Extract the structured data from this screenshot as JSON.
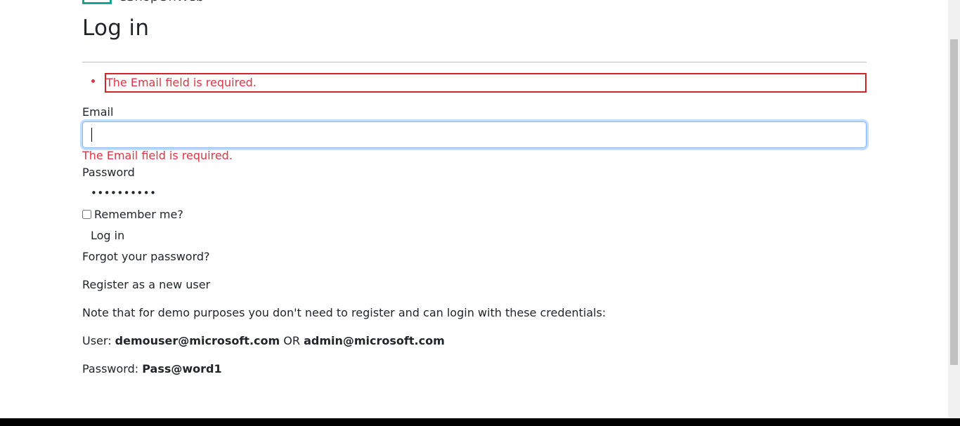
{
  "header": {
    "brand_text": "eShopOnWeb",
    "cart_icon": "cart-icon"
  },
  "page": {
    "title": "Log in"
  },
  "validation_summary": {
    "items": [
      "The Email field is required."
    ],
    "color": "#dc3545"
  },
  "form": {
    "email_label": "Email",
    "email_value": "",
    "email_error": "The Email field is required.",
    "password_label": "Password",
    "password_value": "••••••••••",
    "remember_label": "Remember me?",
    "remember_checked": false,
    "login_button": "Log in"
  },
  "links": {
    "forgot_password": "Forgot your password?",
    "register": "Register as a new user"
  },
  "notes": {
    "demo_note": "Note that for demo purposes you don't need to register and can login with these credentials:",
    "user_prefix": "User: ",
    "user_one": "demouser@microsoft.com",
    "user_or": " OR ",
    "user_two": "admin@microsoft.com",
    "password_prefix": "Password: ",
    "password_value": "Pass@word1"
  }
}
